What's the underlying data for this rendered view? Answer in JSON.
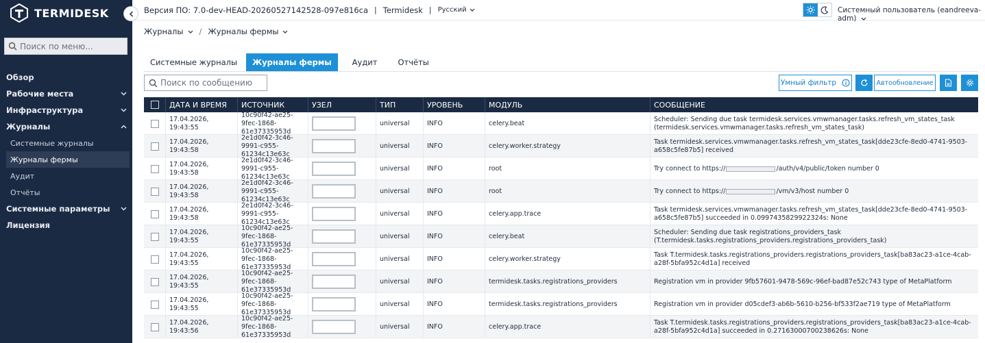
{
  "sidebar": {
    "logo_text": "TERMIDESK",
    "search_placeholder": "Поиск по меню...",
    "items": [
      {
        "label": "Обзор",
        "chevron": ""
      },
      {
        "label": "Рабочие места",
        "chevron": "down"
      },
      {
        "label": "Инфраструктура",
        "chevron": "down"
      },
      {
        "label": "Журналы",
        "chevron": "up"
      },
      {
        "label": "Системные параметры",
        "chevron": "down"
      },
      {
        "label": "Лицензия",
        "chevron": ""
      }
    ],
    "sub_items": [
      {
        "label": "Системные журналы",
        "active": false
      },
      {
        "label": "Журналы фермы",
        "active": true
      },
      {
        "label": "Аудит",
        "active": false
      },
      {
        "label": "Отчёты",
        "active": false
      }
    ]
  },
  "header": {
    "version": "Версия ПО: 7.0-dev-HEAD-20260527142528-097e816ca",
    "product": "Termidesk",
    "language": "Русский",
    "user": "Системный пользователь (eandreeva-adm)"
  },
  "breadcrumb": [
    "Журналы",
    "Журналы фермы"
  ],
  "tabs": [
    {
      "label": "Системные журналы",
      "active": false
    },
    {
      "label": "Журналы фермы",
      "active": true
    },
    {
      "label": "Аудит",
      "active": false
    },
    {
      "label": "Отчёты",
      "active": false
    }
  ],
  "toolbar": {
    "search_placeholder": "Поиск по сообщению",
    "smart_filter_label": "Умный фильтр",
    "auto_refresh_label": "Автообновление"
  },
  "table": {
    "columns": [
      "ДАТА И ВРЕМЯ",
      "ИСТОЧНИК",
      "УЗЕЛ",
      "ТИП",
      "УРОВЕНЬ",
      "МОДУЛЬ",
      "СООБЩЕНИЕ"
    ],
    "rows": [
      {
        "datetime": "17.04.2026, 19:43:55",
        "source": "10c90f42-ae25-9fec-1868-61e37335953d",
        "type": "universal",
        "level": "INFO",
        "module": "celery.beat",
        "message": "Scheduler: Sending due task termidesk.services.vmwmanager.tasks.refresh_vm_states_task (termidesk.services.vmwmanager.tasks.refresh_vm_states_task)"
      },
      {
        "datetime": "17.04.2026, 19:43:58",
        "source": "2e1d0f42-3c46-9991-c955-61234c13e63c",
        "type": "universal",
        "level": "INFO",
        "module": "celery.worker.strategy",
        "message": "Task termidesk.services.vmwmanager.tasks.refresh_vm_states_task[dde23cfe-8ed0-4741-9503-a658c5fe87b5] received"
      },
      {
        "datetime": "17.04.2026, 19:43:58",
        "source": "2e1d0f42-3c46-9991-c955-61234c13e63c",
        "type": "universal",
        "level": "INFO",
        "module": "root",
        "message_pre": "Try connect to https://",
        "message_post": "/auth/v4/public/token number 0"
      },
      {
        "datetime": "17.04.2026, 19:43:58",
        "source": "2e1d0f42-3c46-9991-c955-61234c13e63c",
        "type": "universal",
        "level": "INFO",
        "module": "root",
        "message_pre": "Try connect to https://",
        "message_post": "/vm/v3/host number 0"
      },
      {
        "datetime": "17.04.2026, 19:43:58",
        "source": "2e1d0f42-3c46-9991-c955-61234c13e63c",
        "type": "universal",
        "level": "INFO",
        "module": "celery.app.trace",
        "message": "Task termidesk.services.vmwmanager.tasks.refresh_vm_states_task[dde23cfe-8ed0-4741-9503-a658c5fe87b5] succeeded in 0.0997435829922324s: None"
      },
      {
        "datetime": "17.04.2026, 19:43:55",
        "source": "10c90f42-ae25-9fec-1868-61e37335953d",
        "type": "universal",
        "level": "INFO",
        "module": "celery.beat",
        "message": "Scheduler: Sending due task registrations_providers_task (T.termidesk.tasks.registrations_providers.registrations_providers_task)"
      },
      {
        "datetime": "17.04.2026, 19:43:55",
        "source": "10c90f42-ae25-9fec-1868-61e37335953d",
        "type": "universal",
        "level": "INFO",
        "module": "celery.worker.strategy",
        "message": "Task T.termidesk.tasks.registrations_providers.registrations_providers_task[ba83ac23-a1ce-4cab-a28f-5bfa952c4d1a] received"
      },
      {
        "datetime": "17.04.2026, 19:43:55",
        "source": "10c90f42-ae25-9fec-1868-61e37335953d",
        "type": "universal",
        "level": "INFO",
        "module": "termidesk.tasks.registrations_providers",
        "message": "Registration vm in provider 9fb57601-9478-569c-96ef-bad87e52c743 type of MetaPlatform"
      },
      {
        "datetime": "17.04.2026, 19:43:55",
        "source": "10c90f42-ae25-9fec-1868-61e37335953d",
        "type": "universal",
        "level": "INFO",
        "module": "termidesk.tasks.registrations_providers",
        "message": "Registration vm in provider d05cdef3-ab6b-5610-b256-bf533f2ae719 type of MetaPlatform"
      },
      {
        "datetime": "17.04.2026, 19:43:56",
        "source": "10c90f42-ae25-9fec-1868-61e37335953d",
        "type": "universal",
        "level": "INFO",
        "module": "celery.app.trace",
        "message": "Task T.termidesk.tasks.registrations_providers.registrations_providers_task[ba83ac23-a1ce-4cab-a28f-5bfa952c4d1a] succeeded in 0.27163000700238626s: None"
      }
    ]
  },
  "colors": {
    "sidebar_bg": "#1b2a43",
    "accent": "#1e90d6",
    "table_header_bg": "#1b2a43"
  },
  "icons": [
    "search-icon",
    "chevron-left-icon",
    "sun-icon",
    "moon-icon",
    "info-icon",
    "refresh-icon",
    "export-icon",
    "settings-icon",
    "chevron-down-icon",
    "chevron-up-icon",
    "logo-icon"
  ]
}
